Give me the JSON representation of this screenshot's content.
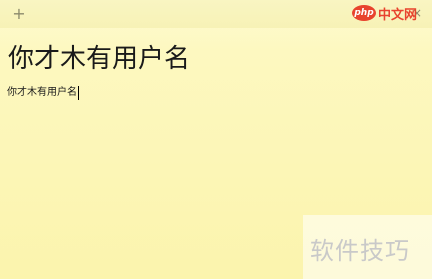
{
  "titlebar": {
    "add_symbol": "+",
    "close_symbol": "×"
  },
  "watermark": {
    "logo_text": "php",
    "site_text": "中文网",
    "bottom_text": "软件技巧"
  },
  "note": {
    "heading": "你才木有用户名",
    "body": "你才木有用户名"
  },
  "icons": {
    "add": "add-icon",
    "close": "close-icon"
  },
  "colors": {
    "note_background": "#fbf4ad",
    "titlebar": "#f7f2b6",
    "text": "#1a1a1a",
    "watermark_red": "#e8442e"
  }
}
